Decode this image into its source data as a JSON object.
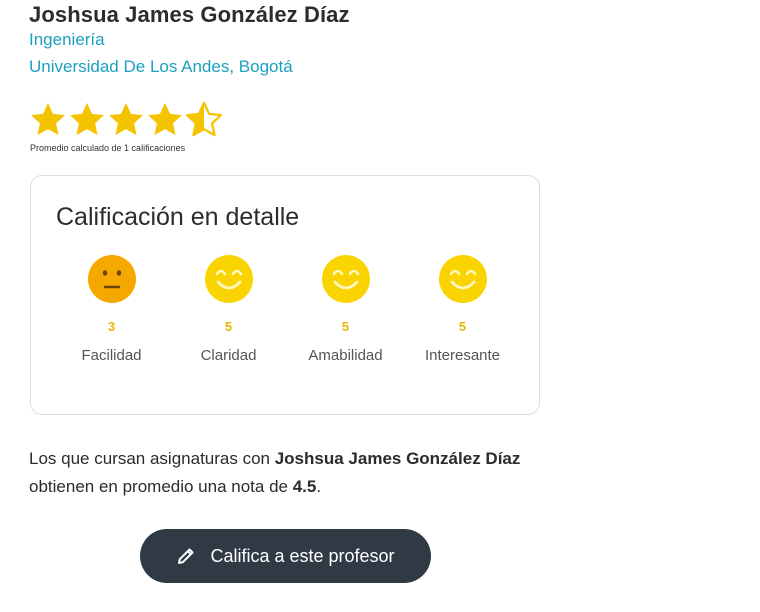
{
  "professor": {
    "name": "Joshsua James González Díaz",
    "department": "Ingeniería",
    "university": "Universidad De Los Andes",
    "separator": ", ",
    "city": "Bogotá"
  },
  "rating": {
    "stars": 4.5,
    "max_stars": 5,
    "note": "Promedio calculado de 1 calificaciones",
    "star_color": "#f5c400"
  },
  "detail": {
    "title": "Calificación en detalle",
    "metrics": [
      {
        "label": "Facilidad",
        "value": "3",
        "face": "neutral-face-icon",
        "color": "#f5a800"
      },
      {
        "label": "Claridad",
        "value": "5",
        "face": "smile-face-icon",
        "color": "#f9d400"
      },
      {
        "label": "Amabilidad",
        "value": "5",
        "face": "smile-face-icon",
        "color": "#f9d400"
      },
      {
        "label": "Interesante",
        "value": "5",
        "face": "smile-face-icon",
        "color": "#f9d400"
      }
    ]
  },
  "summary": {
    "prefix": "Los que cursan asignaturas con ",
    "name": "Joshsua James González Díaz",
    "middle": " obtienen en promedio una nota de ",
    "grade": "4.5",
    "suffix": "."
  },
  "action": {
    "label": "Califica a este profesor",
    "icon": "pencil-icon"
  },
  "colors": {
    "link": "#1ba0c0",
    "button_bg": "#2f3a45",
    "value_text": "#e8b800"
  }
}
